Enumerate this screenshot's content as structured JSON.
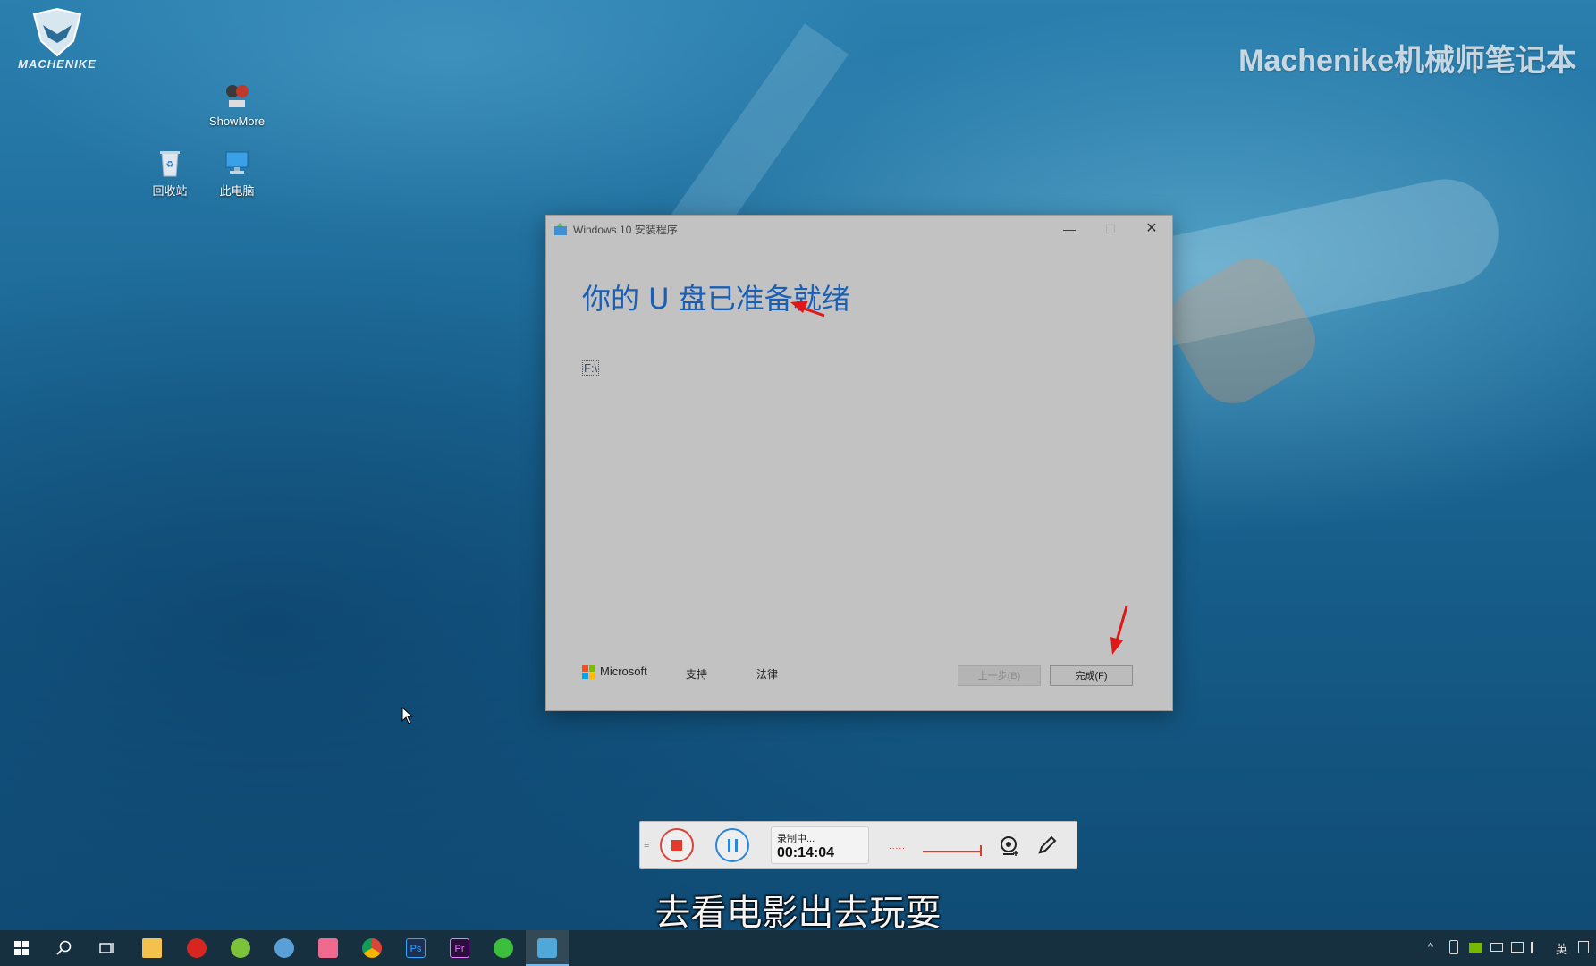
{
  "desktop": {
    "brand_logo_text": "MACHENIKE",
    "watermark": "Machenike机械师笔记本",
    "icons": [
      {
        "label": "ShowMore",
        "icon": "showmore-icon"
      },
      {
        "label": "回收站",
        "icon": "recycle-bin-icon"
      },
      {
        "label": "此电脑",
        "icon": "this-pc-icon"
      }
    ]
  },
  "setup_window": {
    "title": "Windows 10 安装程序",
    "heading": "你的 U 盘已准备就绪",
    "drive": "F:\\",
    "footer": {
      "brand": "Microsoft",
      "support": "支持",
      "legal": "法律"
    },
    "buttons": {
      "back": "上一步(B)",
      "finish": "完成(F)"
    },
    "controls": {
      "minimize": "—",
      "maximize": "☐",
      "close": "✕"
    }
  },
  "recorder": {
    "status": "录制中...",
    "elapsed": "00:14:04",
    "grip": "≡",
    "level_dots": "....."
  },
  "subtitle": "去看电影出去玩耍",
  "taskbar": {
    "items": [
      {
        "name": "start",
        "icon": "windows-start-icon",
        "color": "#ffffff"
      },
      {
        "name": "search",
        "icon": "search-icon",
        "color": "#ffffff"
      },
      {
        "name": "task-view",
        "icon": "task-view-icon",
        "color": "#ffffff"
      },
      {
        "name": "file-explorer",
        "icon": "folder-icon",
        "color": "#f2c14e"
      },
      {
        "name": "netease-music",
        "icon": "netease-music-icon",
        "color": "#d7261f"
      },
      {
        "name": "app-green",
        "icon": "green-app-icon",
        "color": "#7cc23b"
      },
      {
        "name": "app-info",
        "icon": "info-app-icon",
        "color": "#5aa0d8"
      },
      {
        "name": "bilibili",
        "icon": "bilibili-icon",
        "color": "#f06a8f"
      },
      {
        "name": "chrome",
        "icon": "chrome-icon",
        "color": "#e8b52a"
      },
      {
        "name": "photoshop",
        "icon": "photoshop-icon",
        "color": "#1d2f53"
      },
      {
        "name": "premiere",
        "icon": "premiere-icon",
        "color": "#2a0f3b"
      },
      {
        "name": "wechat",
        "icon": "wechat-icon",
        "color": "#3cbf3c"
      },
      {
        "name": "media-creation-tool",
        "icon": "setup-tool-icon",
        "color": "#4fa8d8",
        "active": true
      }
    ],
    "ps_label": "Ps",
    "pr_label": "Pr",
    "tray": {
      "input_language": "英",
      "chevron": "^"
    }
  },
  "colors": {
    "heading_blue": "#1a5fb4",
    "arrow_red": "#e01818",
    "window_bg": "#c2c2c2",
    "taskbar_bg": "#17303f"
  }
}
